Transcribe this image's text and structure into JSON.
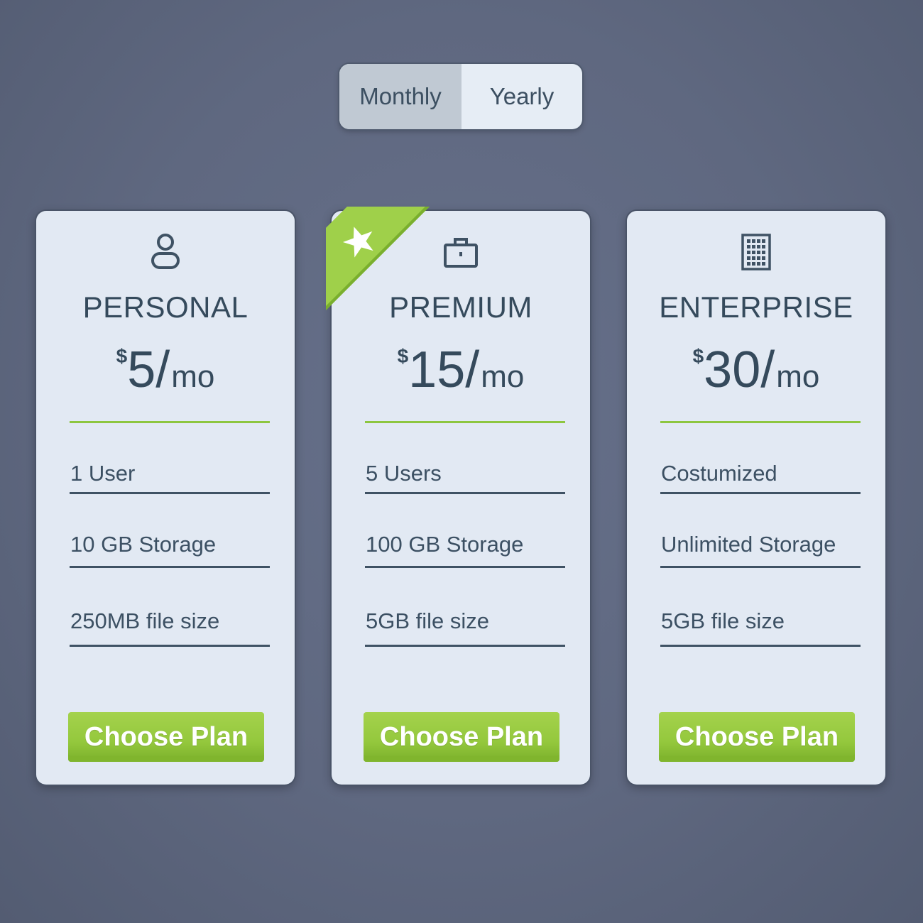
{
  "billing_toggle": {
    "options": [
      "Monthly",
      "Yearly"
    ],
    "selected": "Monthly"
  },
  "plans": [
    {
      "icon": "user-icon",
      "name": "PERSONAL",
      "currency": "$",
      "amount": "5/",
      "period": "mo",
      "features": [
        "1 User",
        "10 GB Storage",
        "250MB file size"
      ],
      "button_label": "Choose Plan"
    },
    {
      "icon": "briefcase-icon",
      "badge_icon": "star-icon",
      "name": "PREMIUM",
      "currency": "$",
      "amount": "15/",
      "period": "mo",
      "features": [
        "5 Users",
        "100 GB Storage",
        "5GB file size"
      ],
      "button_label": "Choose Plan"
    },
    {
      "icon": "building-icon",
      "name": "ENTERPRISE",
      "currency": "$",
      "amount": "30/",
      "period": "mo",
      "features": [
        "Costumized",
        "Unlimited Storage",
        "5GB file size"
      ],
      "button_label": "Choose Plan"
    }
  ],
  "colors": {
    "background": "#5f6880",
    "card": "#e2e9f3",
    "text": "#354a5c",
    "accent_green": "#8dc63f",
    "toggle_active": "#c0c9d3"
  }
}
